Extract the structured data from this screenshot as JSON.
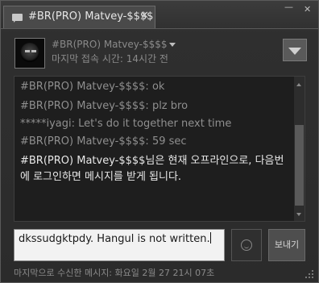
{
  "window": {
    "tab_title": "#BR(PRO) Matvey-$$$$",
    "tab_close": "✕",
    "minimize": "—",
    "close": "✕"
  },
  "friend": {
    "name": "#BR(PRO) Matvey-$$$$",
    "last_online": "마지막 접속 시간: 14시간 전"
  },
  "chat": {
    "messages": [
      "#BR(PRO) Matvey-$$$$: ok",
      "#BR(PRO) Matvey-$$$$: plz bro",
      "*****iyagi: Let's do it together next time",
      "#BR(PRO) Matvey-$$$$: 59 sec"
    ],
    "offline_notice": "#BR(PRO) Matvey-$$$$님은 현재 오프라인으로, 다음번에 로그인하면 메시지를 받게 됩니다."
  },
  "input": {
    "value": "dkssudgktpdy. Hangul is not written."
  },
  "send_label": "보내기",
  "last_received": "마지막으로 수신한 메시지: 화요일  2월 27 21시 07초"
}
